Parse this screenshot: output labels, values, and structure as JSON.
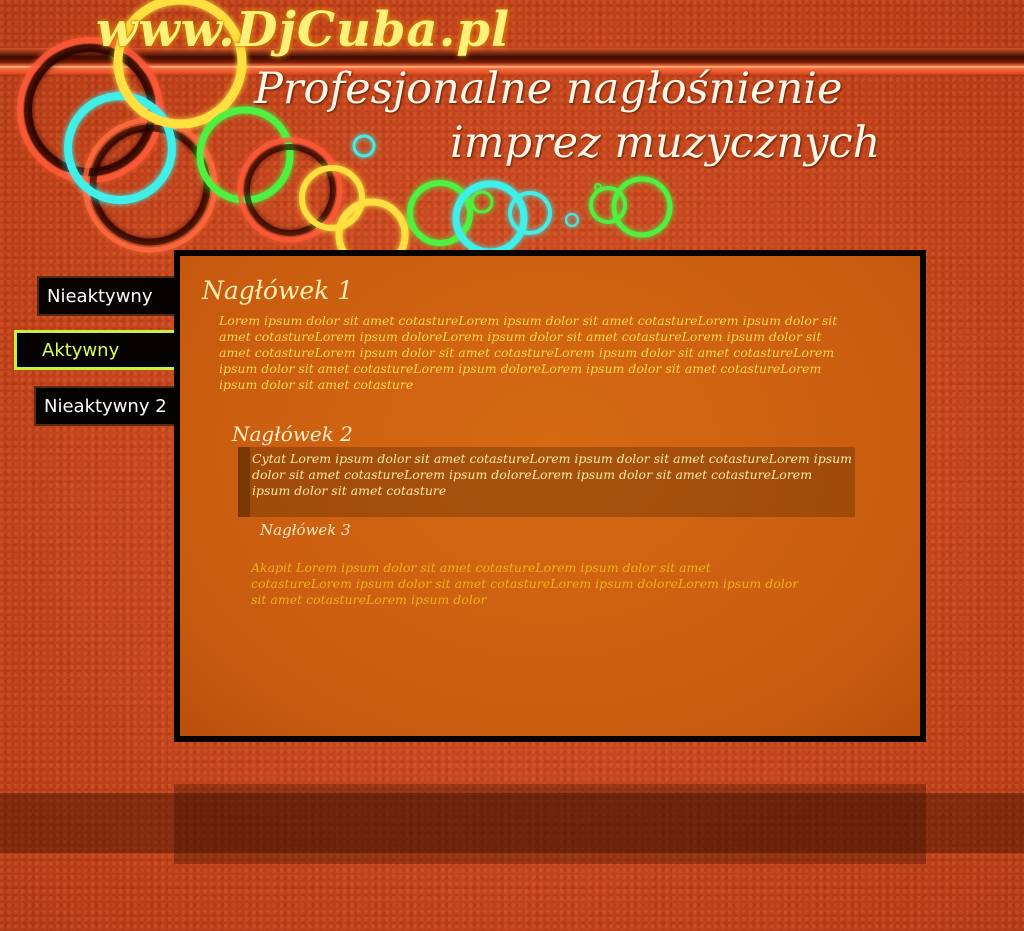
{
  "header": {
    "site_url": "www.DjCuba.pl",
    "tagline_line1": "Profesjonalne nagłośnienie",
    "tagline_line2": "imprez muzycznych"
  },
  "nav": {
    "items": [
      {
        "label": "Nieaktywny",
        "state": "inactive"
      },
      {
        "label": "Aktywny",
        "state": "active"
      },
      {
        "label": "Nieaktywny 2",
        "state": "inactive"
      }
    ]
  },
  "content": {
    "heading1": "Nagłówek 1",
    "paragraph1": "Lorem ipsum dolor sit amet cotastureLorem ipsum dolor sit amet cotastureLorem ipsum dolor sit amet cotastureLorem ipsum doloreLorem ipsum dolor sit amet cotastureLorem ipsum dolor sit amet cotastureLorem ipsum dolor sit amet cotastureLorem ipsum dolor sit amet cotastureLorem ipsum dolor sit amet cotastureLorem ipsum doloreLorem ipsum dolor sit amet cotastureLorem ipsum dolor sit amet cotasture",
    "heading2": "Nagłówek 2",
    "quote": "Cytat Lorem ipsum dolor sit amet cotastureLorem ipsum dolor sit amet cotastureLorem ipsum dolor sit amet cotastureLorem ipsum doloreLorem ipsum dolor sit amet cotastureLorem ipsum dolor sit amet cotasture",
    "heading3": "Nagłówek 3",
    "paragraph2": "Akapit Lorem ipsum dolor sit amet cotastureLorem ipsum dolor sit amet cotastureLorem ipsum dolor sit amet cotastureLorem ipsum doloreLorem ipsum dolor sit amet cotastureLorem ipsum dolor"
  },
  "colors": {
    "background": "#c9461d",
    "nav_active": "#c8f040",
    "heading": "#fff0b0",
    "paragraph": "#ffd84a",
    "content_panel": "#c85a10"
  }
}
